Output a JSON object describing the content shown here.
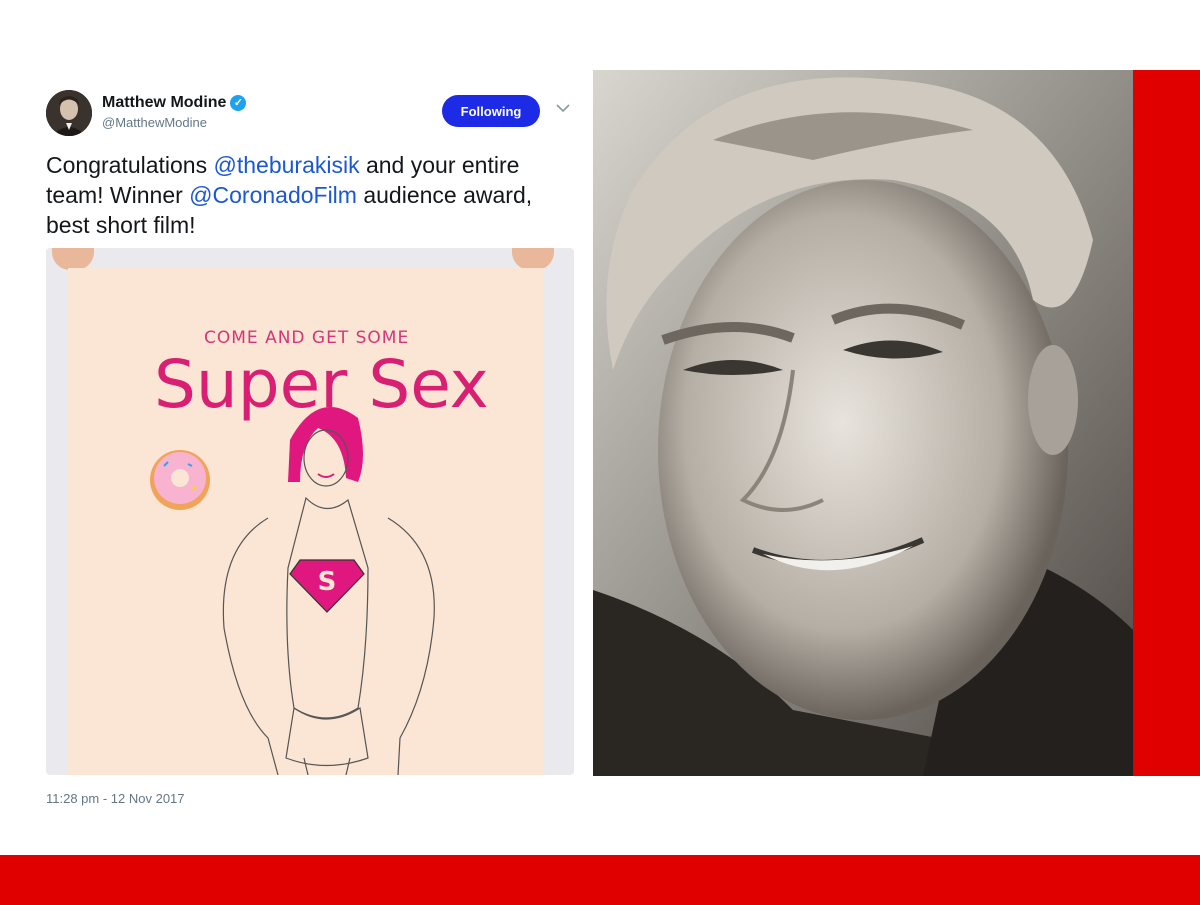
{
  "tweet": {
    "author_name": "Matthew Modine",
    "verified_symbol": "✓",
    "handle": "@MatthewModine",
    "follow_label": "Following",
    "caret": "⌄",
    "text_parts": {
      "p1": "Congratulations ",
      "mention1": "@theburakisik",
      "p2": " and your entire team! Winner ",
      "mention2": "@CoronadoFilm",
      "p3": " audience award, best short film!"
    },
    "timestamp": "11:28 pm - 12 Nov 2017"
  },
  "poster": {
    "pretitle": "COME AND GET SOME",
    "title": "Super Sex"
  },
  "colors": {
    "frame_red": "#e00000",
    "follow_blue": "#1d2be6",
    "mention_blue": "#1b57d6",
    "poster_pink": "#d81f74"
  }
}
